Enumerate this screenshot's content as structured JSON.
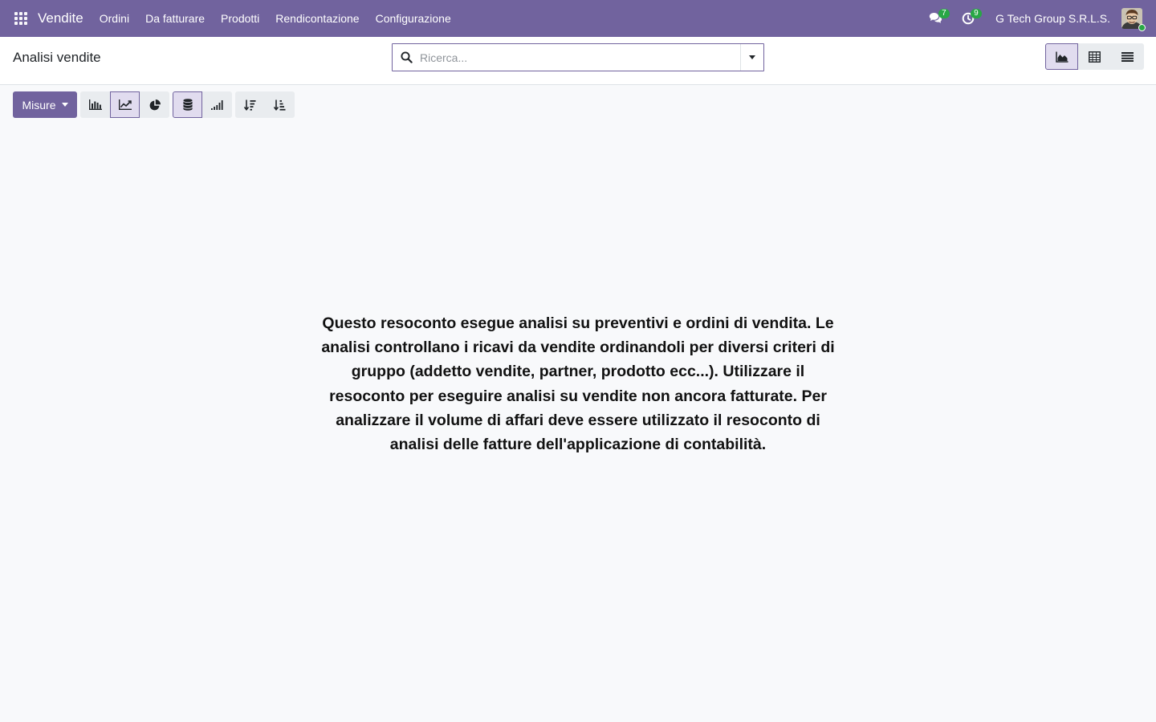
{
  "navbar": {
    "app_name": "Vendite",
    "menu": [
      {
        "label": "Ordini"
      },
      {
        "label": "Da fatturare"
      },
      {
        "label": "Prodotti"
      },
      {
        "label": "Rendicontazione"
      },
      {
        "label": "Configurazione"
      }
    ],
    "messages_count": "7",
    "activities_count": "9",
    "company": "G Tech Group S.R.L.S.",
    "icons": [
      "apps-grid-icon",
      "chat-bubbles-icon",
      "clock-icon",
      "user-avatar"
    ]
  },
  "control_panel": {
    "title": "Analisi vendite",
    "search": {
      "placeholder": "Ricerca...",
      "value": ""
    },
    "views": [
      "graph",
      "pivot",
      "list"
    ],
    "active_view": "graph"
  },
  "toolbar": {
    "measures_label": "Misure",
    "chart_types": [
      "bar-chart-icon",
      "line-chart-icon",
      "pie-chart-icon"
    ],
    "active_chart_type": "line",
    "stacked_active": true,
    "sort_buttons": [
      "sort-descending-icon",
      "sort-ascending-icon"
    ]
  },
  "help_text": "Questo resoconto esegue analisi su preventivi e ordini di vendita. Le analisi controllano i ricavi da vendite ordinandoli per diversi criteri di gruppo (addetto vendite, partner, prodotto ecc...). Utilizzare il resoconto per eseguire analisi su vendite non ancora fatturate. Per analizzare il volume di affari deve essere utilizzato il resoconto di analisi delle fatture dell'applicazione di contabilità.",
  "colors": {
    "brand": "#71639e",
    "background": "#f8f9fb",
    "badge": "#28a745",
    "active_button": "#e1dcef"
  }
}
